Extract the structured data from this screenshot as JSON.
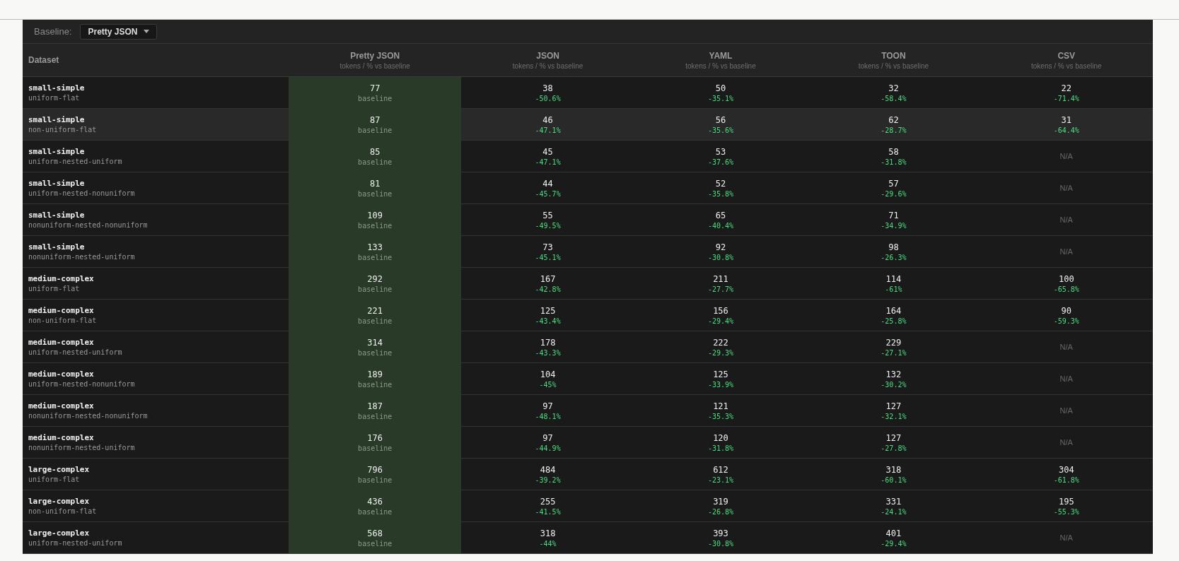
{
  "controls": {
    "label": "Baseline:",
    "select_value": "Pretty JSON"
  },
  "table": {
    "dataset_heading": "Dataset",
    "columns": [
      {
        "name": "Pretty JSON",
        "subtitle": "tokens / % vs baseline",
        "baseline": true
      },
      {
        "name": "JSON",
        "subtitle": "tokens / % vs baseline",
        "baseline": false
      },
      {
        "name": "YAML",
        "subtitle": "tokens / % vs baseline",
        "baseline": false
      },
      {
        "name": "TOON",
        "subtitle": "tokens / % vs baseline",
        "baseline": false
      },
      {
        "name": "CSV",
        "subtitle": "tokens / % vs baseline",
        "baseline": false
      }
    ],
    "rows": [
      {
        "dataset": "small-simple",
        "shape": "uniform-flat",
        "highlighted": false,
        "cells": [
          {
            "kind": "baseline",
            "tokens": "77",
            "note": "baseline"
          },
          {
            "kind": "value",
            "tokens": "38",
            "delta": "-50.6%"
          },
          {
            "kind": "value",
            "tokens": "50",
            "delta": "-35.1%"
          },
          {
            "kind": "value",
            "tokens": "32",
            "delta": "-58.4%"
          },
          {
            "kind": "value",
            "tokens": "22",
            "delta": "-71.4%"
          }
        ]
      },
      {
        "dataset": "small-simple",
        "shape": "non-uniform-flat",
        "highlighted": true,
        "cells": [
          {
            "kind": "baseline",
            "tokens": "87",
            "note": "baseline"
          },
          {
            "kind": "value",
            "tokens": "46",
            "delta": "-47.1%"
          },
          {
            "kind": "value",
            "tokens": "56",
            "delta": "-35.6%"
          },
          {
            "kind": "value",
            "tokens": "62",
            "delta": "-28.7%"
          },
          {
            "kind": "value",
            "tokens": "31",
            "delta": "-64.4%"
          }
        ]
      },
      {
        "dataset": "small-simple",
        "shape": "uniform-nested-uniform",
        "highlighted": false,
        "cells": [
          {
            "kind": "baseline",
            "tokens": "85",
            "note": "baseline"
          },
          {
            "kind": "value",
            "tokens": "45",
            "delta": "-47.1%"
          },
          {
            "kind": "value",
            "tokens": "53",
            "delta": "-37.6%"
          },
          {
            "kind": "value",
            "tokens": "58",
            "delta": "-31.8%"
          },
          {
            "kind": "na",
            "text": "N/A"
          }
        ]
      },
      {
        "dataset": "small-simple",
        "shape": "uniform-nested-nonuniform",
        "highlighted": false,
        "cells": [
          {
            "kind": "baseline",
            "tokens": "81",
            "note": "baseline"
          },
          {
            "kind": "value",
            "tokens": "44",
            "delta": "-45.7%"
          },
          {
            "kind": "value",
            "tokens": "52",
            "delta": "-35.8%"
          },
          {
            "kind": "value",
            "tokens": "57",
            "delta": "-29.6%"
          },
          {
            "kind": "na",
            "text": "N/A"
          }
        ]
      },
      {
        "dataset": "small-simple",
        "shape": "nonuniform-nested-nonuniform",
        "highlighted": false,
        "cells": [
          {
            "kind": "baseline",
            "tokens": "109",
            "note": "baseline"
          },
          {
            "kind": "value",
            "tokens": "55",
            "delta": "-49.5%"
          },
          {
            "kind": "value",
            "tokens": "65",
            "delta": "-40.4%"
          },
          {
            "kind": "value",
            "tokens": "71",
            "delta": "-34.9%"
          },
          {
            "kind": "na",
            "text": "N/A"
          }
        ]
      },
      {
        "dataset": "small-simple",
        "shape": "nonuniform-nested-uniform",
        "highlighted": false,
        "cells": [
          {
            "kind": "baseline",
            "tokens": "133",
            "note": "baseline"
          },
          {
            "kind": "value",
            "tokens": "73",
            "delta": "-45.1%"
          },
          {
            "kind": "value",
            "tokens": "92",
            "delta": "-30.8%"
          },
          {
            "kind": "value",
            "tokens": "98",
            "delta": "-26.3%"
          },
          {
            "kind": "na",
            "text": "N/A"
          }
        ]
      },
      {
        "dataset": "medium-complex",
        "shape": "uniform-flat",
        "highlighted": false,
        "cells": [
          {
            "kind": "baseline",
            "tokens": "292",
            "note": "baseline"
          },
          {
            "kind": "value",
            "tokens": "167",
            "delta": "-42.8%"
          },
          {
            "kind": "value",
            "tokens": "211",
            "delta": "-27.7%"
          },
          {
            "kind": "value",
            "tokens": "114",
            "delta": "-61%"
          },
          {
            "kind": "value",
            "tokens": "100",
            "delta": "-65.8%"
          }
        ]
      },
      {
        "dataset": "medium-complex",
        "shape": "non-uniform-flat",
        "highlighted": false,
        "cells": [
          {
            "kind": "baseline",
            "tokens": "221",
            "note": "baseline"
          },
          {
            "kind": "value",
            "tokens": "125",
            "delta": "-43.4%"
          },
          {
            "kind": "value",
            "tokens": "156",
            "delta": "-29.4%"
          },
          {
            "kind": "value",
            "tokens": "164",
            "delta": "-25.8%"
          },
          {
            "kind": "value",
            "tokens": "90",
            "delta": "-59.3%"
          }
        ]
      },
      {
        "dataset": "medium-complex",
        "shape": "uniform-nested-uniform",
        "highlighted": false,
        "cells": [
          {
            "kind": "baseline",
            "tokens": "314",
            "note": "baseline"
          },
          {
            "kind": "value",
            "tokens": "178",
            "delta": "-43.3%"
          },
          {
            "kind": "value",
            "tokens": "222",
            "delta": "-29.3%"
          },
          {
            "kind": "value",
            "tokens": "229",
            "delta": "-27.1%"
          },
          {
            "kind": "na",
            "text": "N/A"
          }
        ]
      },
      {
        "dataset": "medium-complex",
        "shape": "uniform-nested-nonuniform",
        "highlighted": false,
        "cells": [
          {
            "kind": "baseline",
            "tokens": "189",
            "note": "baseline"
          },
          {
            "kind": "value",
            "tokens": "104",
            "delta": "-45%"
          },
          {
            "kind": "value",
            "tokens": "125",
            "delta": "-33.9%"
          },
          {
            "kind": "value",
            "tokens": "132",
            "delta": "-30.2%"
          },
          {
            "kind": "na",
            "text": "N/A"
          }
        ]
      },
      {
        "dataset": "medium-complex",
        "shape": "nonuniform-nested-nonuniform",
        "highlighted": false,
        "cells": [
          {
            "kind": "baseline",
            "tokens": "187",
            "note": "baseline"
          },
          {
            "kind": "value",
            "tokens": "97",
            "delta": "-48.1%"
          },
          {
            "kind": "value",
            "tokens": "121",
            "delta": "-35.3%"
          },
          {
            "kind": "value",
            "tokens": "127",
            "delta": "-32.1%"
          },
          {
            "kind": "na",
            "text": "N/A"
          }
        ]
      },
      {
        "dataset": "medium-complex",
        "shape": "nonuniform-nested-uniform",
        "highlighted": false,
        "cells": [
          {
            "kind": "baseline",
            "tokens": "176",
            "note": "baseline"
          },
          {
            "kind": "value",
            "tokens": "97",
            "delta": "-44.9%"
          },
          {
            "kind": "value",
            "tokens": "120",
            "delta": "-31.8%"
          },
          {
            "kind": "value",
            "tokens": "127",
            "delta": "-27.8%"
          },
          {
            "kind": "na",
            "text": "N/A"
          }
        ]
      },
      {
        "dataset": "large-complex",
        "shape": "uniform-flat",
        "highlighted": false,
        "cells": [
          {
            "kind": "baseline",
            "tokens": "796",
            "note": "baseline"
          },
          {
            "kind": "value",
            "tokens": "484",
            "delta": "-39.2%"
          },
          {
            "kind": "value",
            "tokens": "612",
            "delta": "-23.1%"
          },
          {
            "kind": "value",
            "tokens": "318",
            "delta": "-60.1%"
          },
          {
            "kind": "value",
            "tokens": "304",
            "delta": "-61.8%"
          }
        ]
      },
      {
        "dataset": "large-complex",
        "shape": "non-uniform-flat",
        "highlighted": false,
        "cells": [
          {
            "kind": "baseline",
            "tokens": "436",
            "note": "baseline"
          },
          {
            "kind": "value",
            "tokens": "255",
            "delta": "-41.5%"
          },
          {
            "kind": "value",
            "tokens": "319",
            "delta": "-26.8%"
          },
          {
            "kind": "value",
            "tokens": "331",
            "delta": "-24.1%"
          },
          {
            "kind": "value",
            "tokens": "195",
            "delta": "-55.3%"
          }
        ]
      },
      {
        "dataset": "large-complex",
        "shape": "uniform-nested-uniform",
        "highlighted": false,
        "cells": [
          {
            "kind": "baseline",
            "tokens": "568",
            "note": "baseline"
          },
          {
            "kind": "value",
            "tokens": "318",
            "delta": "-44%"
          },
          {
            "kind": "value",
            "tokens": "393",
            "delta": "-30.8%"
          },
          {
            "kind": "value",
            "tokens": "401",
            "delta": "-29.4%"
          },
          {
            "kind": "na",
            "text": "N/A"
          }
        ]
      }
    ]
  }
}
